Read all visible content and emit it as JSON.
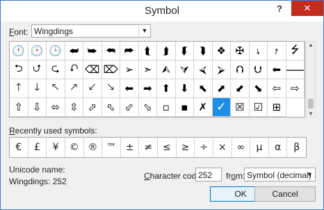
{
  "title": "Symbol",
  "help_label": "?",
  "close_label": "✕",
  "font": {
    "label_prefix": "F",
    "label_rest": "ont:",
    "value": "Wingdings"
  },
  "symbols": [
    {
      "glyph": "🕐",
      "icon": "clock-1-icon"
    },
    {
      "glyph": "🕑",
      "icon": "clock-2-icon"
    },
    {
      "glyph": "🕒",
      "icon": "clock-3-icon"
    },
    {
      "glyph": "⮨",
      "icon": "arrow-icon"
    },
    {
      "glyph": "⮩",
      "icon": "arrow-icon"
    },
    {
      "glyph": "⮪",
      "icon": "arrow-icon"
    },
    {
      "glyph": "⮫",
      "icon": "arrow-icon"
    },
    {
      "glyph": "⮬",
      "icon": "arrow-icon"
    },
    {
      "glyph": "⮭",
      "icon": "arrow-icon"
    },
    {
      "glyph": "⮮",
      "icon": "arrow-icon"
    },
    {
      "glyph": "⮯",
      "icon": "arrow-icon"
    },
    {
      "glyph": "❖",
      "icon": "ornament-icon"
    },
    {
      "glyph": "✠",
      "icon": "ornament-icon"
    },
    {
      "glyph": "⭏",
      "icon": "arrow-icon"
    },
    {
      "glyph": "⭎",
      "icon": "arrow-icon"
    },
    {
      "glyph": "⭍",
      "icon": "arrow-icon"
    },
    {
      "glyph": "⮌",
      "icon": "arrow-icon"
    },
    {
      "glyph": "⮍",
      "icon": "arrow-icon"
    },
    {
      "glyph": "⮎",
      "icon": "arrow-icon"
    },
    {
      "glyph": "⮏",
      "icon": "arrow-icon"
    },
    {
      "glyph": "⌫",
      "icon": "backspace-icon"
    },
    {
      "glyph": "⌦",
      "icon": "delete-icon"
    },
    {
      "glyph": "➢",
      "icon": "arrowhead-icon"
    },
    {
      "glyph": "➣",
      "icon": "arrowhead-icon"
    },
    {
      "glyph": "⮙",
      "icon": "arrowhead-icon"
    },
    {
      "glyph": "⮛",
      "icon": "arrowhead-icon"
    },
    {
      "glyph": "⮘",
      "icon": "arrow-circle-icon"
    },
    {
      "glyph": "⮚",
      "icon": "arrow-circle-icon"
    },
    {
      "glyph": "⮉",
      "icon": "arrow-circle-icon"
    },
    {
      "glyph": "⮋",
      "icon": "arrow-circle-icon"
    },
    {
      "glyph": "⬅",
      "icon": "left-arrow-icon"
    },
    {
      "glyph": "🡒",
      "icon": "right-arrow-icon"
    },
    {
      "glyph": "🡑",
      "icon": "up-arrow-icon"
    },
    {
      "glyph": "🡓",
      "icon": "down-arrow-icon"
    },
    {
      "glyph": "🡔",
      "icon": "up-left-arrow-icon"
    },
    {
      "glyph": "🡕",
      "icon": "up-right-arrow-icon"
    },
    {
      "glyph": "🡗",
      "icon": "down-left-arrow-icon"
    },
    {
      "glyph": "🡖",
      "icon": "down-right-arrow-icon"
    },
    {
      "glyph": "⬅",
      "icon": "left-arrow-icon"
    },
    {
      "glyph": "➡",
      "icon": "right-arrow-icon"
    },
    {
      "glyph": "⬆",
      "icon": "up-arrow-icon"
    },
    {
      "glyph": "⬇",
      "icon": "down-arrow-icon"
    },
    {
      "glyph": "⬉",
      "icon": "up-left-arrow-icon"
    },
    {
      "glyph": "⬈",
      "icon": "up-right-arrow-icon"
    },
    {
      "glyph": "⬋",
      "icon": "down-left-arrow-icon"
    },
    {
      "glyph": "⬊",
      "icon": "down-right-arrow-icon"
    },
    {
      "glyph": "⇦",
      "icon": "outline-left-arrow-icon"
    },
    {
      "glyph": "⇨",
      "icon": "outline-right-arrow-icon"
    },
    {
      "glyph": "⇧",
      "icon": "outline-up-arrow-icon"
    },
    {
      "glyph": "⇩",
      "icon": "outline-down-arrow-icon"
    },
    {
      "glyph": "⬄",
      "icon": "outline-left-right-arrow-icon"
    },
    {
      "glyph": "⇳",
      "icon": "outline-up-down-arrow-icon"
    },
    {
      "glyph": "⬀",
      "icon": "outline-up-left-arrow-icon"
    },
    {
      "glyph": "⬁",
      "icon": "outline-up-right-arrow-icon"
    },
    {
      "glyph": "⬃",
      "icon": "outline-down-left-arrow-icon"
    },
    {
      "glyph": "⬂",
      "icon": "outline-down-right-arrow-icon"
    },
    {
      "glyph": "▫",
      "icon": "small-square-icon"
    },
    {
      "glyph": "▪",
      "icon": "small-square-icon"
    },
    {
      "glyph": "✗",
      "icon": "x-mark-icon"
    },
    {
      "glyph": "✓",
      "icon": "check-mark-icon"
    },
    {
      "glyph": "☒",
      "icon": "ballot-box-x-icon"
    },
    {
      "glyph": "☑",
      "icon": "ballot-box-check-icon"
    },
    {
      "glyph": "⊞",
      "icon": "windows-logo-icon"
    }
  ],
  "selected_index": 59,
  "recent": {
    "label_prefix": "R",
    "label_rest": "ecently used symbols:",
    "symbols": [
      "€",
      "£",
      "¥",
      "©",
      "®",
      "™",
      "±",
      "≠",
      "≤",
      "≥",
      "÷",
      "×",
      "∞",
      "µ",
      "α",
      "β"
    ]
  },
  "unicode": {
    "label": "Unicode name:",
    "value": "Wingdings: 252"
  },
  "char_code": {
    "label_prefix": "C",
    "label_rest": "haracter code:",
    "value": "252"
  },
  "from": {
    "label_prefix": "fr",
    "label_u": "o",
    "label_rest": "m:",
    "value": "Symbol (decimal)"
  },
  "buttons": {
    "ok": "OK",
    "cancel": "Cancel"
  }
}
